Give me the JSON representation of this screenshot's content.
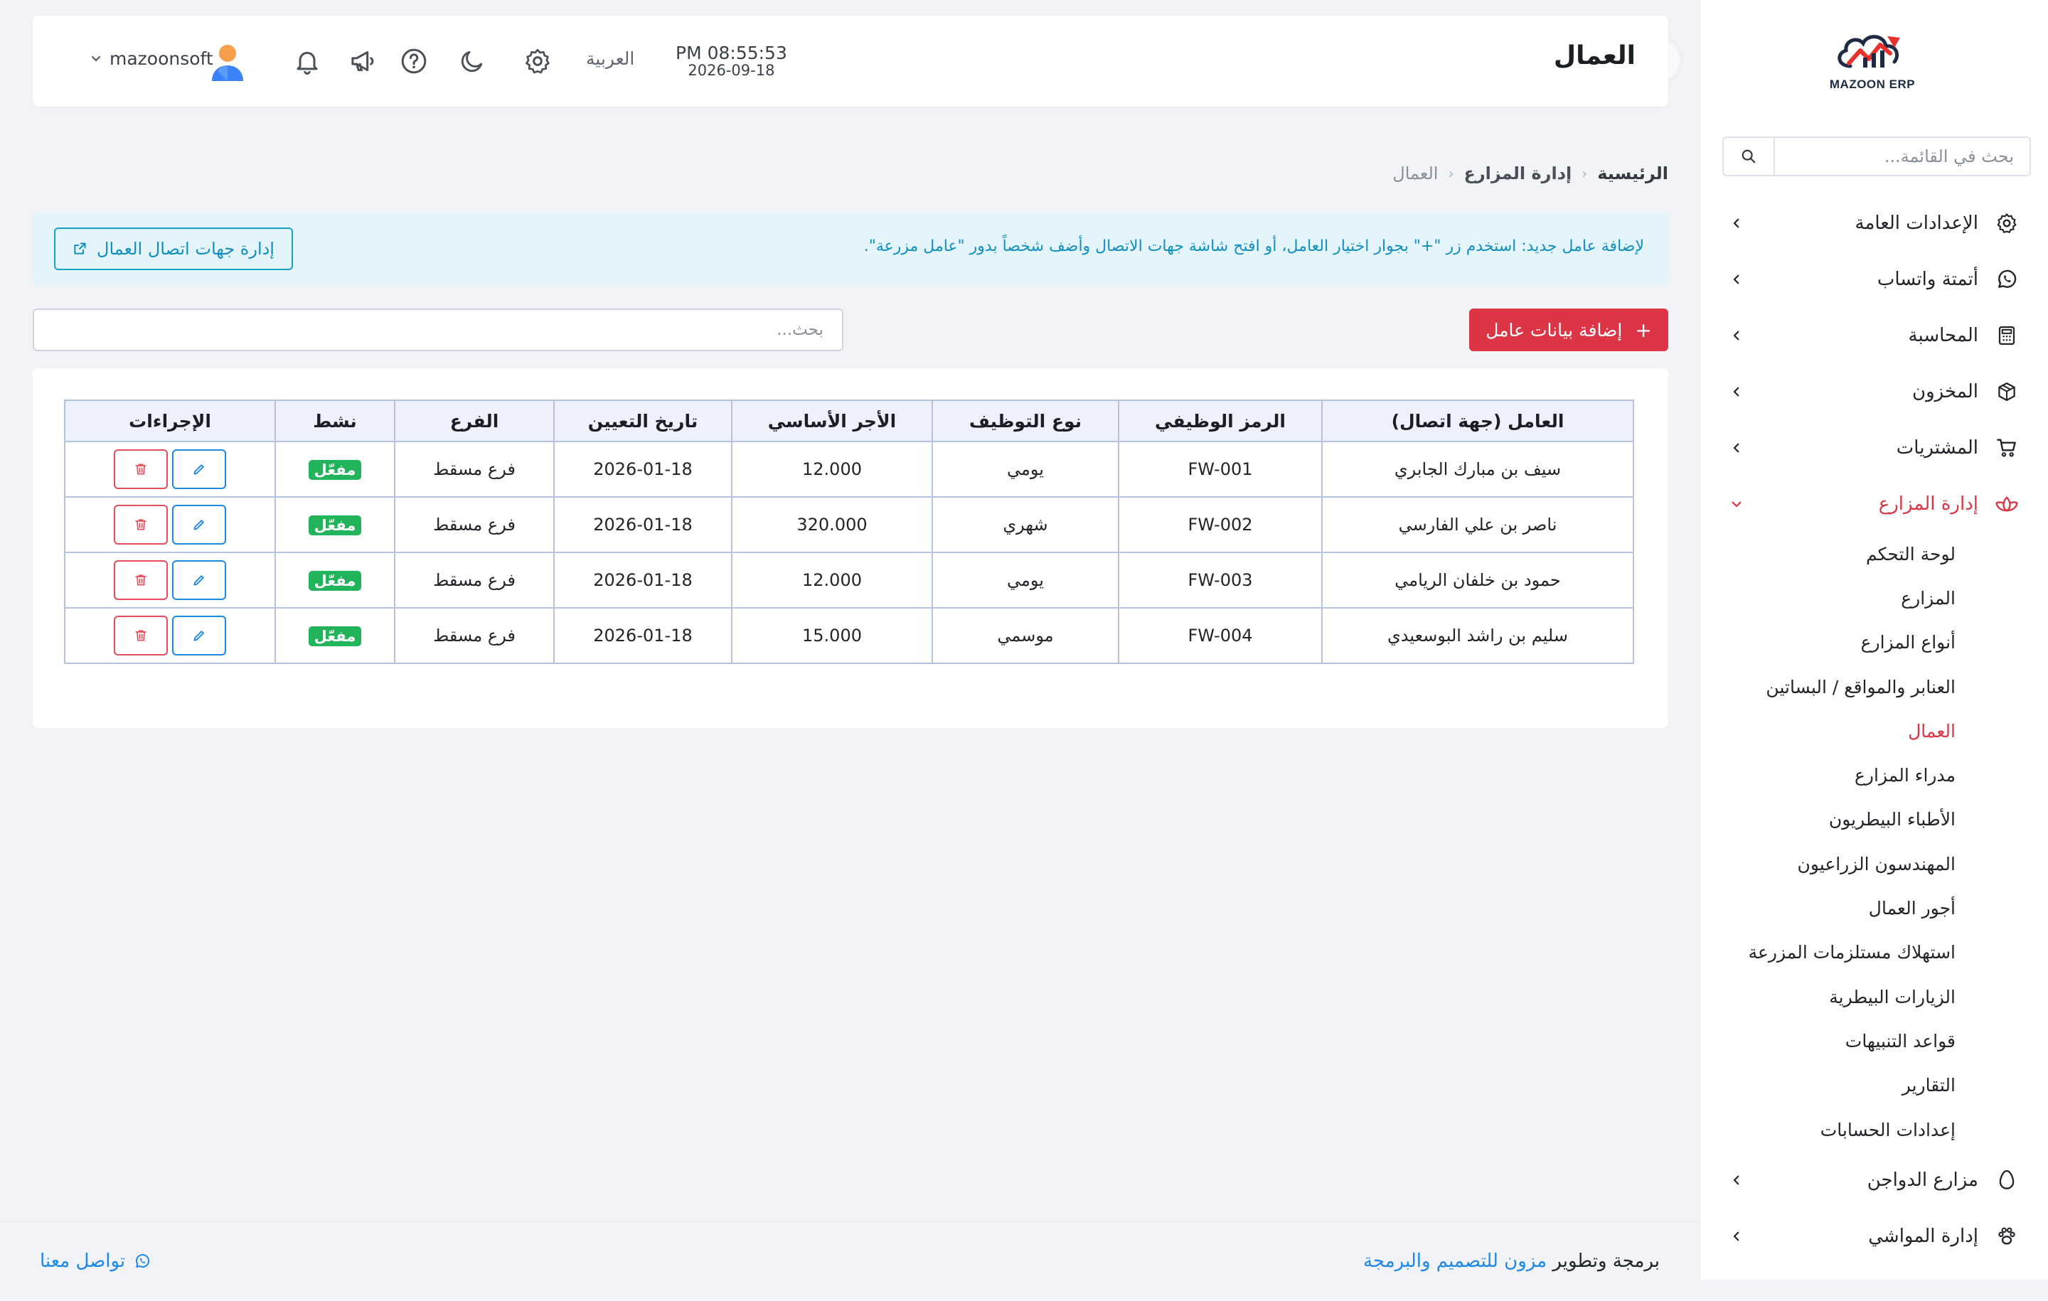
{
  "brand": {
    "name": "MAZOON ERP",
    "tagline": "ERP"
  },
  "header": {
    "title": "العمال",
    "time": "PM 08:55:53",
    "date": "2026-09-18",
    "language": "العربية",
    "username": "mazoonsoft"
  },
  "sidebar": {
    "search_placeholder": "بحث في القائمة...",
    "items": [
      {
        "label": "الإعدادات العامة",
        "icon": "gear-icon"
      },
      {
        "label": "أتمتة واتساب",
        "icon": "whatsapp-icon"
      },
      {
        "label": "المحاسبة",
        "icon": "calculator-icon"
      },
      {
        "label": "المخزون",
        "icon": "box-icon"
      },
      {
        "label": "المشتريات",
        "icon": "cart-icon"
      },
      {
        "label": "إدارة المزارع",
        "icon": "lotus-icon",
        "expanded": true
      }
    ],
    "subitems": [
      "لوحة التحكم",
      "المزارع",
      "أنواع المزارع",
      "العنابر والمواقع / البساتين",
      "العمال",
      "مدراء المزارع",
      "الأطباء البيطريون",
      "المهندسون الزراعيون",
      "أجور العمال",
      "استهلاك مستلزمات المزرعة",
      "الزيارات البيطرية",
      "قواعد التنبيهات",
      "التقارير",
      "إعدادات الحسابات"
    ],
    "active_subitem": "العمال",
    "tail_items": [
      {
        "label": "مزارع الدواجن",
        "icon": "egg-icon"
      },
      {
        "label": "إدارة المواشي",
        "icon": "paw-icon"
      }
    ]
  },
  "breadcrumb": {
    "home": "الرئيسية",
    "section": "إدارة المزارع",
    "current": "العمال"
  },
  "alert": {
    "text": "لإضافة عامل جديد: استخدم زر \"+\" بجوار اختيار العامل، أو افتح شاشة جهات الاتصال وأضف شخصاً بدور \"عامل مزرعة\".",
    "button": "إدارة جهات اتصال العمال"
  },
  "actions": {
    "add_button": "إضافة بيانات عامل",
    "search_placeholder": "بحث..."
  },
  "table": {
    "headers": [
      "العامل (جهة اتصال)",
      "الرمز الوظيفي",
      "نوع التوظيف",
      "الأجر الأساسي",
      "تاريخ التعيين",
      "الفرع",
      "نشط",
      "الإجراءات"
    ],
    "rows": [
      [
        "سيف بن مبارك الجابري",
        "FW-001",
        "يومي",
        "12.000",
        "2026-01-18",
        "فرع مسقط",
        "مفعّل"
      ],
      [
        "ناصر بن علي الفارسي",
        "FW-002",
        "شهري",
        "320.000",
        "2026-01-18",
        "فرع مسقط",
        "مفعّل"
      ],
      [
        "حمود بن خلفان الريامي",
        "FW-003",
        "يومي",
        "12.000",
        "2026-01-18",
        "فرع مسقط",
        "مفعّل"
      ],
      [
        "سليم بن راشد البوسعيدي",
        "FW-004",
        "موسمي",
        "15.000",
        "2026-01-18",
        "فرع مسقط",
        "مفعّل"
      ]
    ]
  },
  "footer": {
    "prefix": "برمجة وتطوير",
    "company": "مزون للتصميم والبرمجة",
    "contact": "تواصل معنا"
  },
  "colors": {
    "accent": "#dc3545",
    "info": "#138fbd",
    "success": "#22b45a",
    "link": "#1e88e5"
  }
}
